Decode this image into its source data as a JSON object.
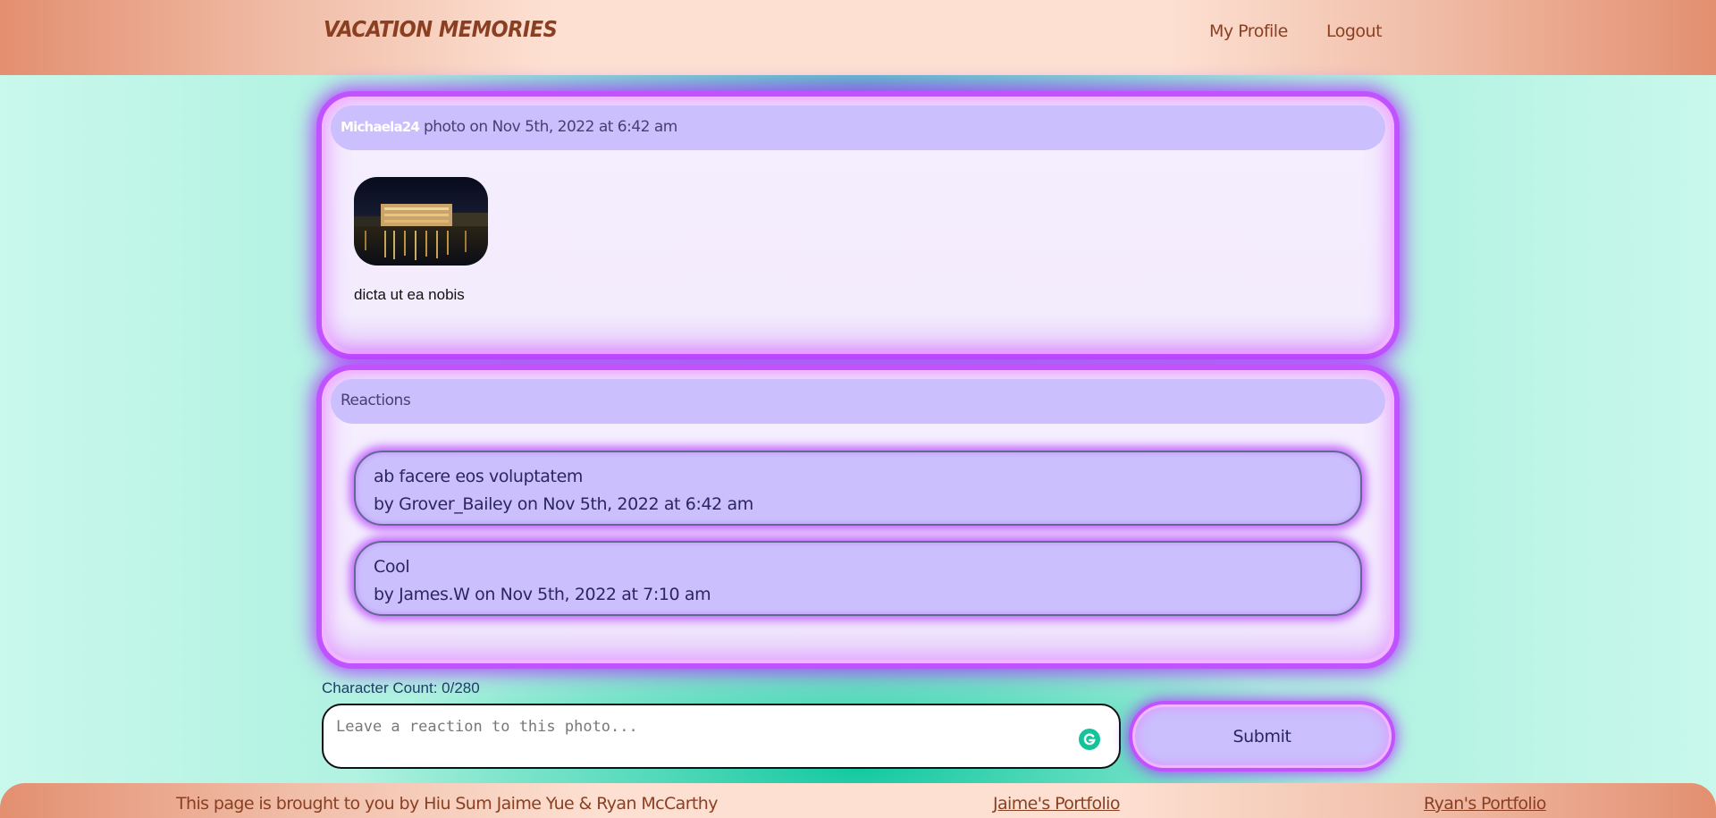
{
  "header": {
    "site_title": "Vacation Memories",
    "nav": [
      {
        "label": "My Profile"
      },
      {
        "label": "Logout"
      }
    ]
  },
  "post": {
    "author": "Michaela24",
    "meta": "photo on Nov 5th, 2022 at 6:42 am",
    "caption": "dicta ut ea nobis"
  },
  "reactions": {
    "heading": "Reactions",
    "items": [
      {
        "text": "ab facere eos voluptatem",
        "byline": "by Grover_Bailey on Nov 5th, 2022 at 6:42 am"
      },
      {
        "text": "Cool",
        "byline": "by James.W on Nov 5th, 2022 at 7:10 am"
      }
    ]
  },
  "form": {
    "char_count": "Character Count: 0/280",
    "placeholder": "Leave a reaction to this photo...",
    "submit_label": "Submit"
  },
  "footer": {
    "credit": "This page is brought to you by Hiu Sum Jaime Yue & Ryan McCarthy",
    "links": [
      {
        "label": "Jaime's Portfolio"
      },
      {
        "label": "Ryan's Portfolio"
      }
    ]
  },
  "icons": {
    "grammar": "grammar-check-icon"
  },
  "colors": {
    "accent_glow": "#c152ff",
    "card_header": "#cbc0fd",
    "header_text": "#8a3f22",
    "footer_bg": "#fde0d2",
    "page_bg": "#a6efdc"
  }
}
